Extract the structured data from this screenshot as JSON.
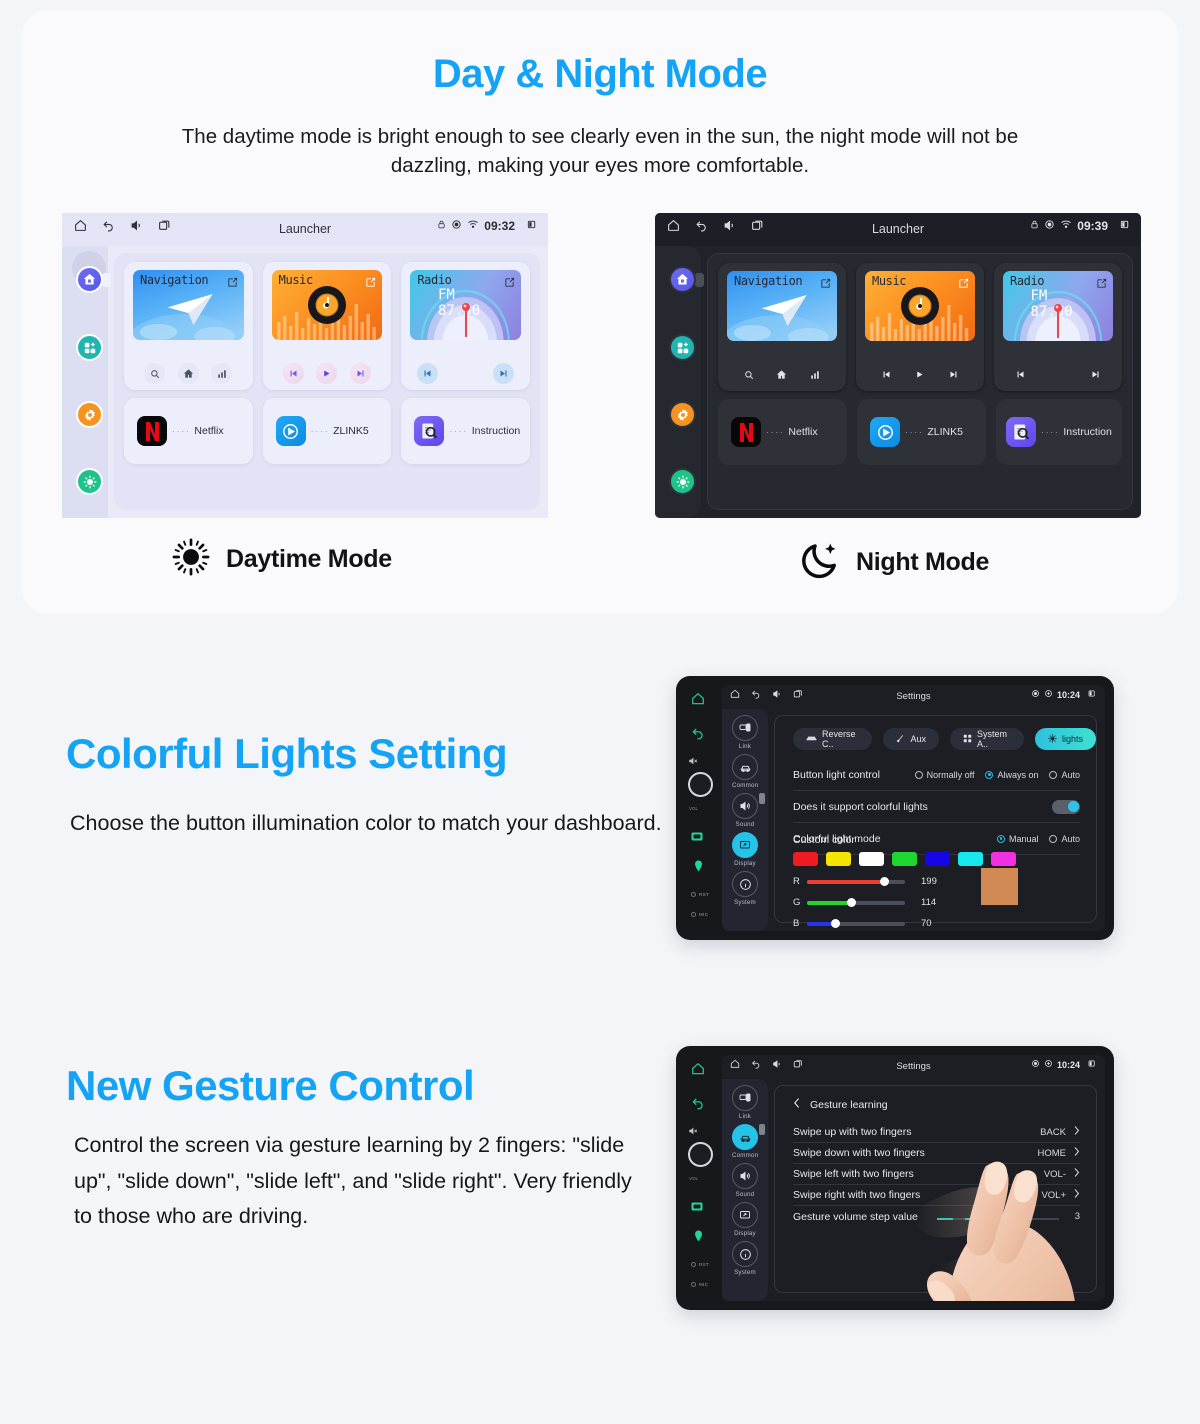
{
  "sections": {
    "daynight": {
      "title": "Day & Night Mode",
      "subtitle": "The daytime mode is bright enough to see clearly even in the sun, the night mode will not be dazzling, making your eyes more comfortable.",
      "day_caption": "Daytime Mode",
      "night_caption": "Night Mode"
    },
    "lights": {
      "title": "Colorful Lights Setting",
      "body": "Choose the button illumination color to match your dashboard."
    },
    "gesture": {
      "title": "New Gesture Control",
      "body": "Control the screen via gesture learning by 2 fingers: \"slide up\", \"slide down\", \"slide left\", and \"slide right\". Very friendly to those who are driving."
    }
  },
  "launcher_day": {
    "status_title": "Launcher",
    "time": "09:32",
    "tiles": [
      {
        "label": "Navigation",
        "controls": [
          "search-icon",
          "home-icon",
          "equalizer-icon"
        ]
      },
      {
        "label": "Music",
        "controls": [
          "prev-icon",
          "play-icon",
          "next-icon"
        ]
      },
      {
        "label": "Radio",
        "sub": "FM 87.50",
        "controls": [
          "prev-icon",
          "next-icon"
        ]
      }
    ],
    "apps": [
      {
        "label": "Netflix",
        "icon": "netflix-icon"
      },
      {
        "label": "ZLINK5",
        "icon": "zlink-icon"
      },
      {
        "label": "Instruction",
        "icon": "instruction-icon"
      }
    ],
    "rail": [
      "home-icon",
      "apps-icon",
      "settings-icon",
      "brightness-icon"
    ]
  },
  "launcher_night": {
    "status_title": "Launcher",
    "time": "09:39",
    "tiles": [
      {
        "label": "Navigation",
        "controls": [
          "search-icon",
          "home-icon",
          "equalizer-icon"
        ]
      },
      {
        "label": "Music",
        "controls": [
          "prev-icon",
          "play-icon",
          "next-icon"
        ]
      },
      {
        "label": "Radio",
        "sub": "FM 87.50",
        "controls": [
          "prev-icon",
          "next-icon"
        ]
      }
    ],
    "apps": [
      {
        "label": "Netflix",
        "icon": "netflix-icon"
      },
      {
        "label": "ZLINK5",
        "icon": "zlink-icon"
      },
      {
        "label": "Instruction",
        "icon": "instruction-icon"
      }
    ],
    "rail": [
      "home-icon",
      "apps-icon",
      "settings-icon",
      "brightness-icon"
    ]
  },
  "lights_screen": {
    "status_title": "Settings",
    "time": "10:24",
    "side_rail": [
      "Link",
      "Common",
      "Sound",
      "Display",
      "System"
    ],
    "side_active": "Display",
    "side_dots": [
      "RST",
      "MIC"
    ],
    "chips": [
      {
        "label": "Reverse C..",
        "icon": "car-icon",
        "active": false
      },
      {
        "label": "Aux",
        "icon": "aux-icon",
        "active": false
      },
      {
        "label": "System A..",
        "icon": "grid-icon",
        "active": false
      },
      {
        "label": "lights",
        "icon": "sun-icon",
        "active": true
      }
    ],
    "rows": [
      {
        "label": "Button light control",
        "type": "radio",
        "options": [
          "Normally off",
          "Always on",
          "Auto"
        ],
        "selected": "Always on"
      },
      {
        "label": "Does it support colorful lights",
        "type": "toggle",
        "value": true
      },
      {
        "label": "Colorful light mode",
        "type": "radio",
        "options": [
          "Manual",
          "Auto"
        ],
        "selected": "Manual"
      }
    ],
    "custom_color_label": "Custom color",
    "swatches": [
      "#ee1c20",
      "#f5e300",
      "#ffffff",
      "#1fd630",
      "#1505e7",
      "#16e9ee",
      "#f330e1"
    ],
    "sliders": [
      {
        "channel": "R",
        "value": 199,
        "max": 255,
        "color": "#ef3b32"
      },
      {
        "channel": "G",
        "value": 114,
        "max": 255,
        "color": "#27d22e"
      },
      {
        "channel": "B",
        "value": 70,
        "max": 255,
        "color": "#2833ef"
      }
    ],
    "preview_color": "#d18a54"
  },
  "gesture_screen": {
    "status_title": "Settings",
    "time": "10:24",
    "side_rail": [
      "Link",
      "Common",
      "Sound",
      "Display",
      "System"
    ],
    "side_active": "Common",
    "side_dots": [
      "RST",
      "MIC"
    ],
    "back_label": "Gesture learning",
    "rows": [
      {
        "label": "Swipe up with two fingers",
        "value": "BACK"
      },
      {
        "label": "Swipe down with two fingers",
        "value": "HOME"
      },
      {
        "label": "Swipe left with two fingers",
        "value": "VOL-"
      },
      {
        "label": "Swipe right with two fingers",
        "value": "VOL+"
      }
    ],
    "step_row": {
      "label": "Gesture volume step value",
      "value": "3"
    }
  },
  "colors": {
    "accent_blue": "#14a3f5",
    "page_bg": "#f4f5f8",
    "card_bg": "#fafafc",
    "night_bg": "#21232a",
    "day_bg": "#e9eaf8"
  }
}
